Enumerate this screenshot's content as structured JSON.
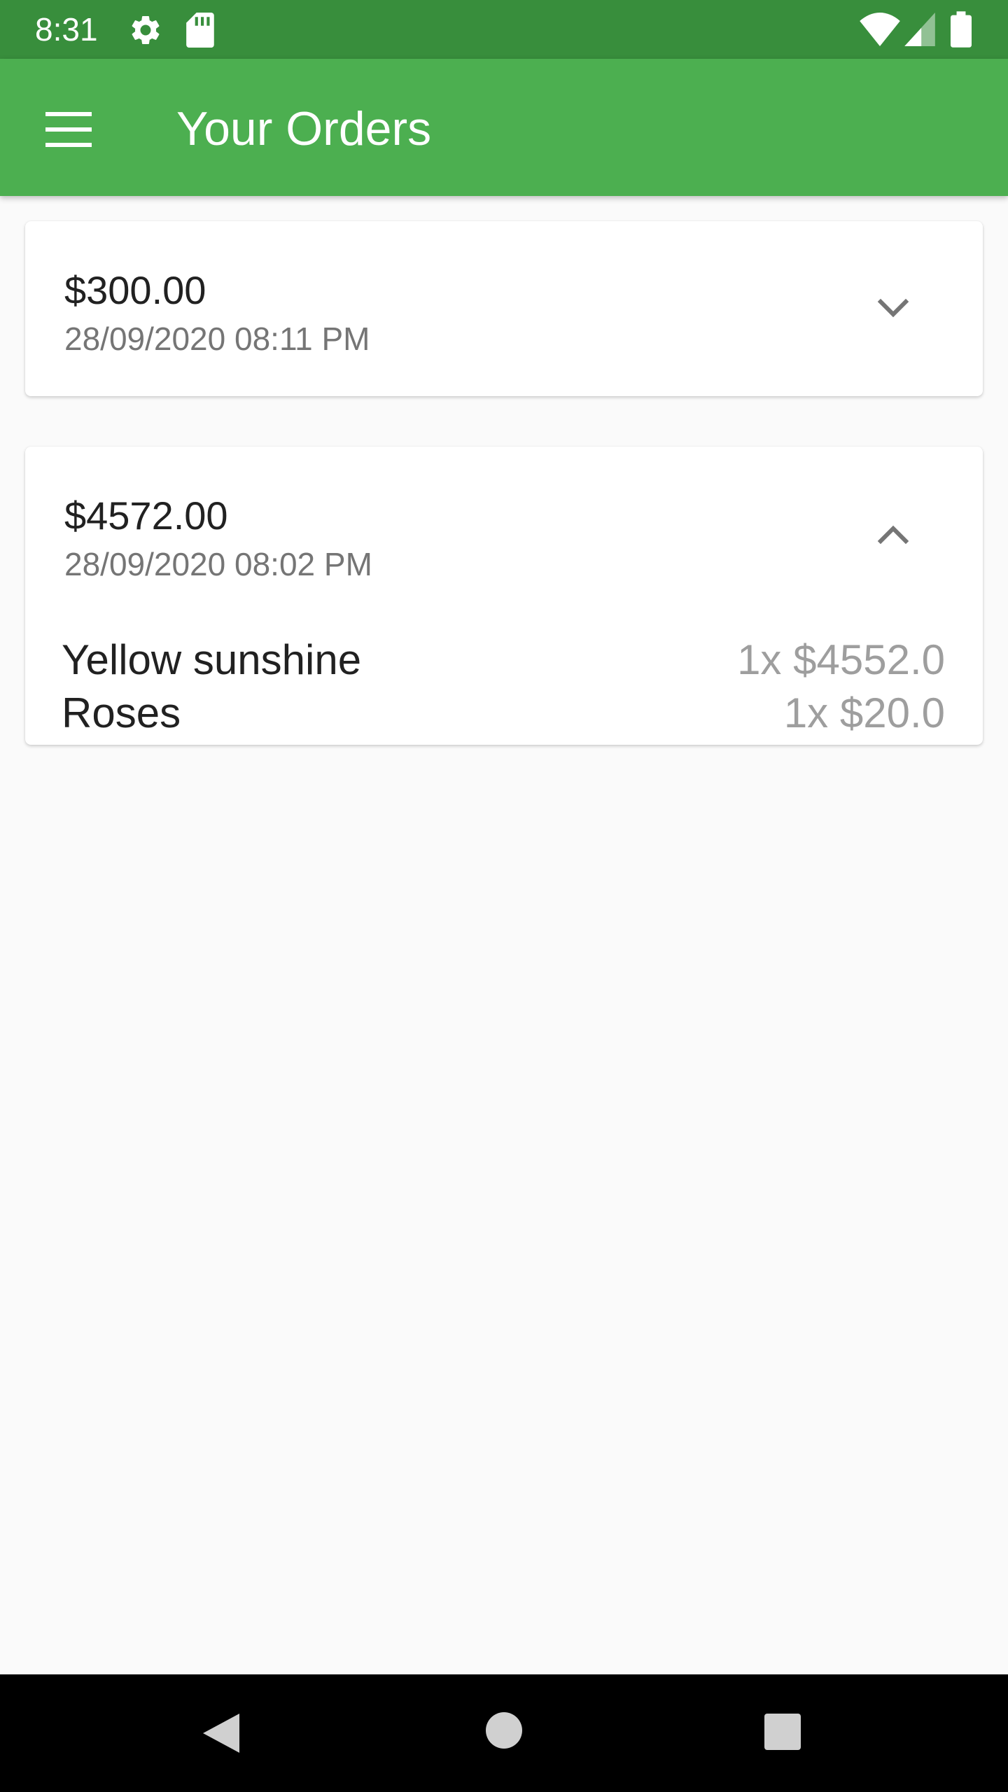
{
  "status_bar": {
    "time": "8:31",
    "icons": [
      "gear-icon",
      "sd-card-icon",
      "wifi-icon",
      "cell-signal-icon",
      "battery-icon"
    ]
  },
  "app_bar": {
    "title": "Your Orders",
    "menu_icon": "hamburger-menu-icon"
  },
  "orders": [
    {
      "amount": "$300.00",
      "datetime": "28/09/2020 08:11 PM",
      "expanded": false,
      "toggle_icon": "chevron-down-icon",
      "items": []
    },
    {
      "amount": "$4572.00",
      "datetime": "28/09/2020 08:02 PM",
      "expanded": true,
      "toggle_icon": "chevron-up-icon",
      "items": [
        {
          "name": "Yellow sunshine",
          "qty_price": "1x $4552.0"
        },
        {
          "name": "Roses",
          "qty_price": "1x $20.0"
        }
      ]
    }
  ],
  "nav_bar": {
    "buttons": [
      "back-icon",
      "home-icon",
      "recents-icon"
    ]
  },
  "colors": {
    "status_bar": "#388e3c",
    "app_bar": "#4caf50",
    "background": "#fafafa",
    "primary_text": "#212121",
    "secondary_text": "#757575",
    "muted_text": "#9e9e9e"
  }
}
